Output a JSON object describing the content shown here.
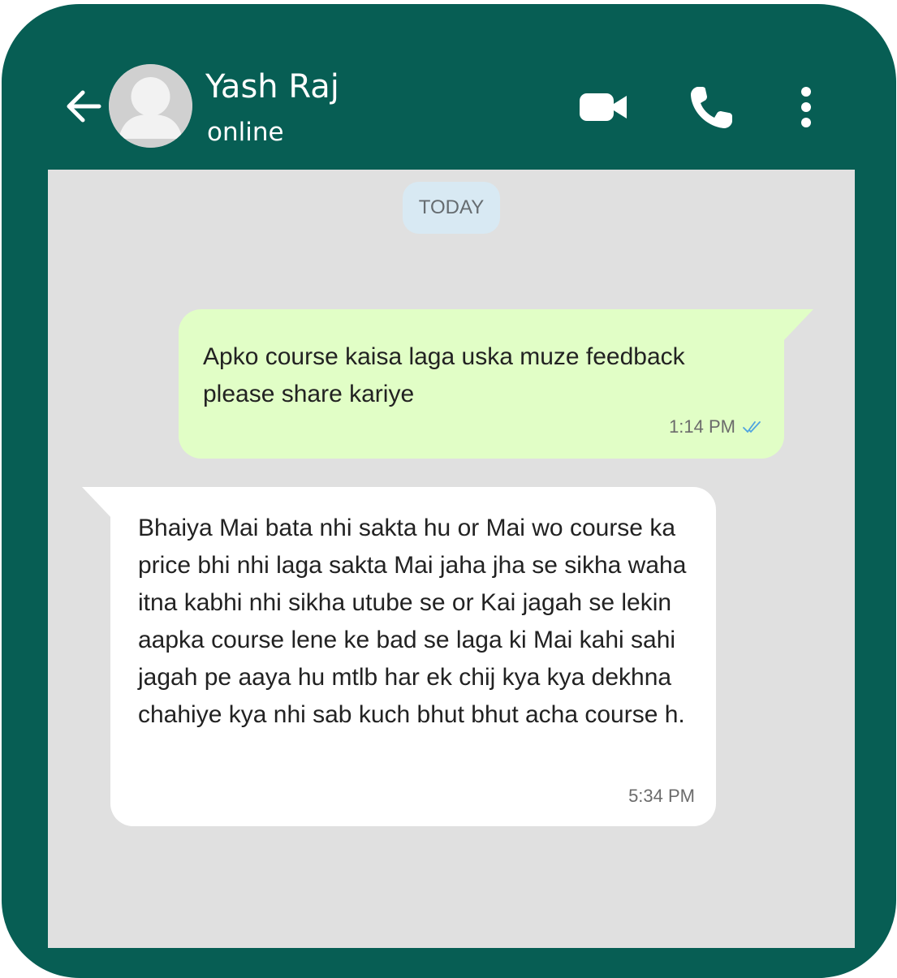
{
  "header": {
    "contact_name": "Yash Raj",
    "status": "online",
    "icons": [
      "back-arrow-icon",
      "avatar",
      "video-call-icon",
      "phone-call-icon",
      "more-options-icon"
    ]
  },
  "chat": {
    "date_chip": "TODAY",
    "messages": [
      {
        "direction": "outgoing",
        "text": "Apko course kaisa laga uska muze feedback please share kariye",
        "time": "1:14 PM",
        "status_icon": "double-check-icon"
      },
      {
        "direction": "incoming",
        "text": "Bhaiya Mai bata nhi sakta hu or Mai wo course ka price bhi nhi laga sakta Mai jaha jha se sikha waha itna kabhi nhi sikha utube se or Kai jagah se lekin aapka course lene ke bad se laga ki Mai kahi sahi jagah pe aaya hu mtlb har ek chij kya kya dekhna chahiye kya nhi sab kuch bhut bhut acha course h.",
        "time": "5:34 PM"
      }
    ]
  },
  "colors": {
    "header_bg": "#075e54",
    "chat_bg": "#e0e0e0",
    "outgoing_bubble": "#e1fec6",
    "incoming_bubble": "#ffffff",
    "date_chip_bg": "#d8e9f3",
    "read_tick": "#4fa3e0"
  }
}
